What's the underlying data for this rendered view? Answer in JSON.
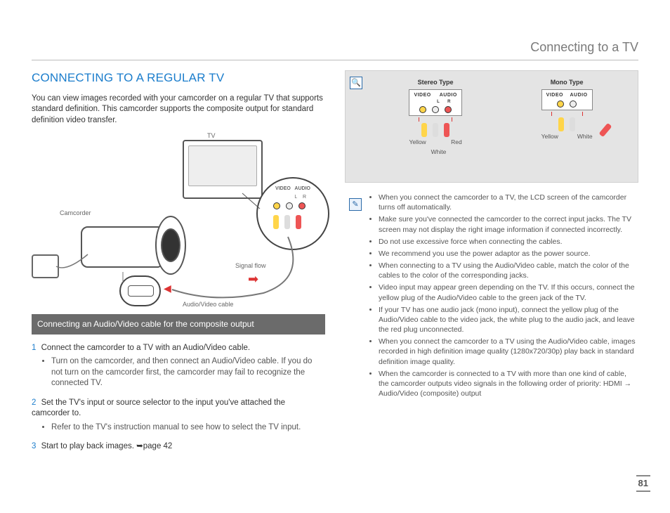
{
  "header": {
    "section_title": "Connecting to a TV"
  },
  "left": {
    "heading": "CONNECTING TO A REGULAR TV",
    "intro": "You can view images recorded with your camcorder on a regular TV that supports standard definition. This camcorder supports the composite output for standard definition video transfer.",
    "diagram": {
      "tv_label": "TV",
      "camcorder_label": "Camcorder",
      "signal_flow": "Signal flow",
      "av_cable": "Audio/Video cable",
      "video_label": "VIDEO",
      "audio_label": "AUDIO",
      "l_label": "L",
      "r_label": "R"
    },
    "sub_heading": "Connecting an Audio/Video cable for the composite output",
    "steps": [
      {
        "num": "1",
        "text": "Connect the camcorder to a TV with an Audio/Video cable.",
        "sub": [
          "Turn on the camcorder, and then connect an Audio/Video cable. If you do not turn on the camcorder first, the camcorder may fail to recognize the connected TV."
        ]
      },
      {
        "num": "2",
        "text": "Set the TV's input or source selector to the input you've attached the camcorder to.",
        "sub": [
          "Refer to the TV's instruction manual to see how to select the TV input."
        ]
      },
      {
        "num": "3",
        "text": "Start to play back images. ➥page 42",
        "sub": []
      }
    ]
  },
  "right": {
    "box": {
      "stereo_title": "Stereo Type",
      "mono_title": "Mono Type",
      "video": "VIDEO",
      "audio": "AUDIO",
      "l": "L",
      "r": "R",
      "yellow": "Yellow",
      "white": "White",
      "red": "Red"
    },
    "notes": [
      "When you connect the camcorder to a TV, the LCD screen of the camcorder turns off automatically.",
      "Make sure you've connected the camcorder to the correct input jacks. The TV screen may not display the right image information if connected incorrectly.",
      "Do not use excessive force when connecting the cables.",
      "We recommend you use the power adaptor as the power source.",
      "When connecting to a TV using the Audio/Video cable, match the color of the cables to the color of the corresponding jacks.",
      "Video input may appear green depending on the TV. If this occurs, connect the yellow plug of the Audio/Video cable to the green jack of the TV.",
      "If your TV has one audio jack (mono input), connect the yellow plug of the Audio/Video cable to the video jack, the white plug to the audio jack, and leave the red plug unconnected.",
      "When you connect the camcorder to a TV using the Audio/Video cable, images recorded in high definition image quality (1280x720/30p) play back in standard definition image quality.",
      "When the camcorder is connected to a TV with more than one kind of cable, the camcorder outputs video signals in the following order of priority: HDMI → Audio/Video (composite) output"
    ]
  },
  "page": "81"
}
